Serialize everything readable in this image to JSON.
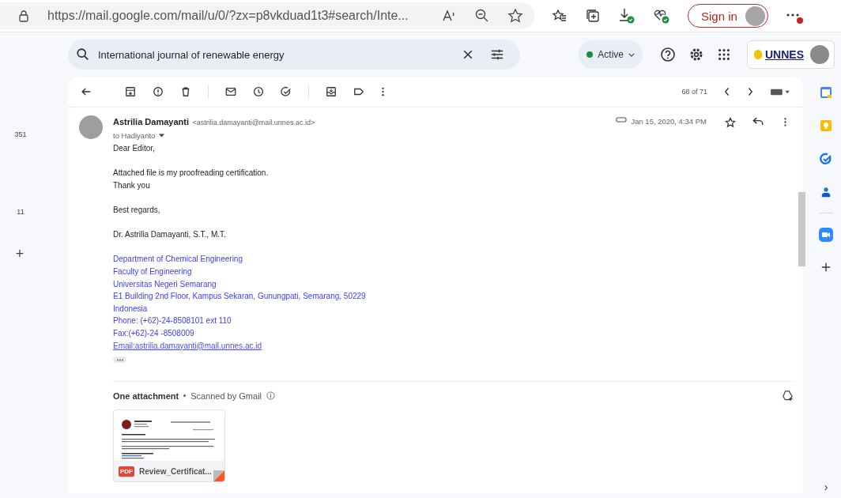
{
  "browser": {
    "url": "https://mail.google.com/mail/u/0/?zx=p8vkduad1t3#search/Inte...",
    "sign_in": "Sign in"
  },
  "left_rail": [
    {
      "kind": "count",
      "label": "351"
    },
    {
      "kind": "count",
      "label": "11"
    },
    {
      "kind": "add",
      "label": "+"
    }
  ],
  "search": {
    "value": "International journal of renewable energy"
  },
  "status": {
    "label": "Active"
  },
  "account": {
    "logo": "UNNES"
  },
  "toolbar": {
    "count": "68 of 71"
  },
  "message": {
    "sender": "Astrilia Damayanti",
    "email": "<astrilia.damayanti@mail.unnes.ac.id>",
    "to": "to Hadiyanto",
    "date": "Jan 15, 2020, 4:34 PM",
    "starred": false,
    "paragraphs": [
      {
        "lines": [
          "Dear Editor,"
        ]
      },
      {
        "lines": [
          "Attached file is my proofreading certification.",
          "Thank you"
        ]
      },
      {
        "lines": [
          "Best regards,"
        ]
      }
    ],
    "signature_name": "Dr. Astrilia Damayanti, S.T., M.T.",
    "signature": [
      {
        "kind": "text",
        "text": "Department of Chemical Engineering"
      },
      {
        "kind": "text",
        "text": "Faculty of Engineering"
      },
      {
        "kind": "text",
        "text": "Universitas Negeri Semarang"
      },
      {
        "kind": "text",
        "text": "E1 Building 2nd Floor, Kampus Sekaran, Gunungpati, Semarang, 50229"
      },
      {
        "kind": "text",
        "text": "Indonesia"
      },
      {
        "kind": "text",
        "text": "Phone: (+62)-24-8508101 ext 110"
      },
      {
        "kind": "text",
        "text": "Fax:(+62)-24 -8508009"
      },
      {
        "kind": "link",
        "text": "Email:astrilia.damayanti@mail.unnes.ac.id"
      }
    ]
  },
  "attachments": {
    "title": "One attachment",
    "scan": "Scanned by Gmail",
    "files": [
      {
        "name": "Review_Certificat...",
        "type": "PDF"
      }
    ]
  },
  "right_rail": {
    "next": "›"
  }
}
